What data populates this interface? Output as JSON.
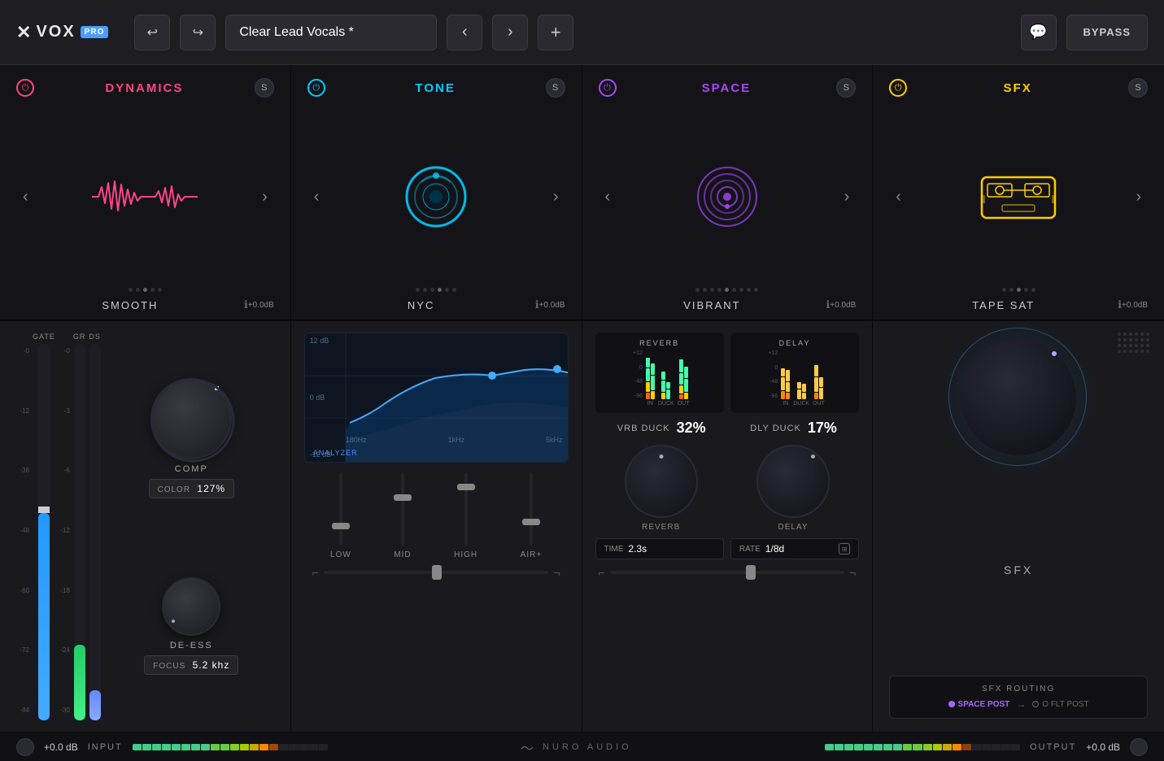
{
  "header": {
    "logo_x": "✕",
    "logo_vox": "VOX",
    "logo_pro": "PRO",
    "undo_label": "↩",
    "redo_label": "↪",
    "preset_name": "Clear Lead Vocals *",
    "prev_label": "‹",
    "next_label": "›",
    "add_label": "+",
    "comment_label": "💬",
    "bypass_label": "BYPASS"
  },
  "panels_top": [
    {
      "title": "DYNAMICS",
      "preset": "SMOOTH",
      "color": "dynamics",
      "db": "+0.0dB",
      "dots": [
        0,
        0,
        1,
        0,
        0
      ]
    },
    {
      "title": "TONE",
      "preset": "NYC",
      "color": "tone",
      "db": "+0.0dB",
      "dots": [
        0,
        0,
        0,
        1,
        0,
        0
      ]
    },
    {
      "title": "SPACE",
      "preset": "VIBRANT",
      "color": "space",
      "db": "+0.0dB",
      "dots": [
        0,
        0,
        0,
        0,
        1,
        0,
        0,
        0,
        0
      ]
    },
    {
      "title": "SFX",
      "preset": "TAPE SAT",
      "color": "sfx",
      "db": "+0.0dB",
      "dots": [
        0,
        0,
        1,
        0,
        0
      ]
    }
  ],
  "dynamics_panel": {
    "gate_label": "GATE",
    "gr_label": "GR",
    "ds_label": "DS",
    "comp_label": "COMP",
    "color_label": "COLOR",
    "color_value": "127%",
    "de_ess_label": "DE-ESS",
    "focus_label": "FOCUS",
    "focus_value": "5.2 khz",
    "db_marks": [
      "-0",
      "-12",
      "-36",
      "-48",
      "-60",
      "-72",
      "-84"
    ],
    "gr_marks": [
      "-0",
      "-3",
      "-6",
      "-12",
      "-18",
      "-24",
      "-30"
    ],
    "ds_marks": [
      "-0",
      ""
    ]
  },
  "tone_panel": {
    "analyzer_label": "ANALYZER",
    "db_12": "12 dB",
    "db_0": "0 dB",
    "db_neg12": "-12 dB",
    "hz_180": "180Hz",
    "hz_1k": "1kHz",
    "hz_5k": "5kHz",
    "low_label": "LOW",
    "mid_label": "MID",
    "high_label": "HIGH",
    "air_label": "AIR+"
  },
  "space_panel": {
    "reverb_label": "REVERB",
    "delay_label": "DELAY",
    "vrb_duck_label": "VRB DUCK",
    "vrb_duck_value": "32%",
    "dly_duck_label": "DLY DUCK",
    "dly_duck_value": "17%",
    "reverb_knob_label": "REVERB",
    "delay_knob_label": "DELAY",
    "time_label": "TIME",
    "time_value": "2.3s",
    "rate_label": "RATE",
    "rate_value": "1/8d",
    "meter_labels": [
      "IN",
      "DUCK",
      "OUT"
    ],
    "scale_12": "+12",
    "scale_0": "0",
    "scale_48": "-48",
    "scale_96": "-96"
  },
  "sfx_panel": {
    "sfx_label": "SFX",
    "routing_title": "SFX ROUTING",
    "space_post": "SPACE POST",
    "arrow": "→",
    "flt_post": "O FLT POST"
  },
  "footer": {
    "input_db": "+0.0 dB",
    "input_label": "INPUT",
    "output_label": "OUTPUT",
    "output_db": "+0.0 dB",
    "brand": "NURO AUDIO"
  }
}
